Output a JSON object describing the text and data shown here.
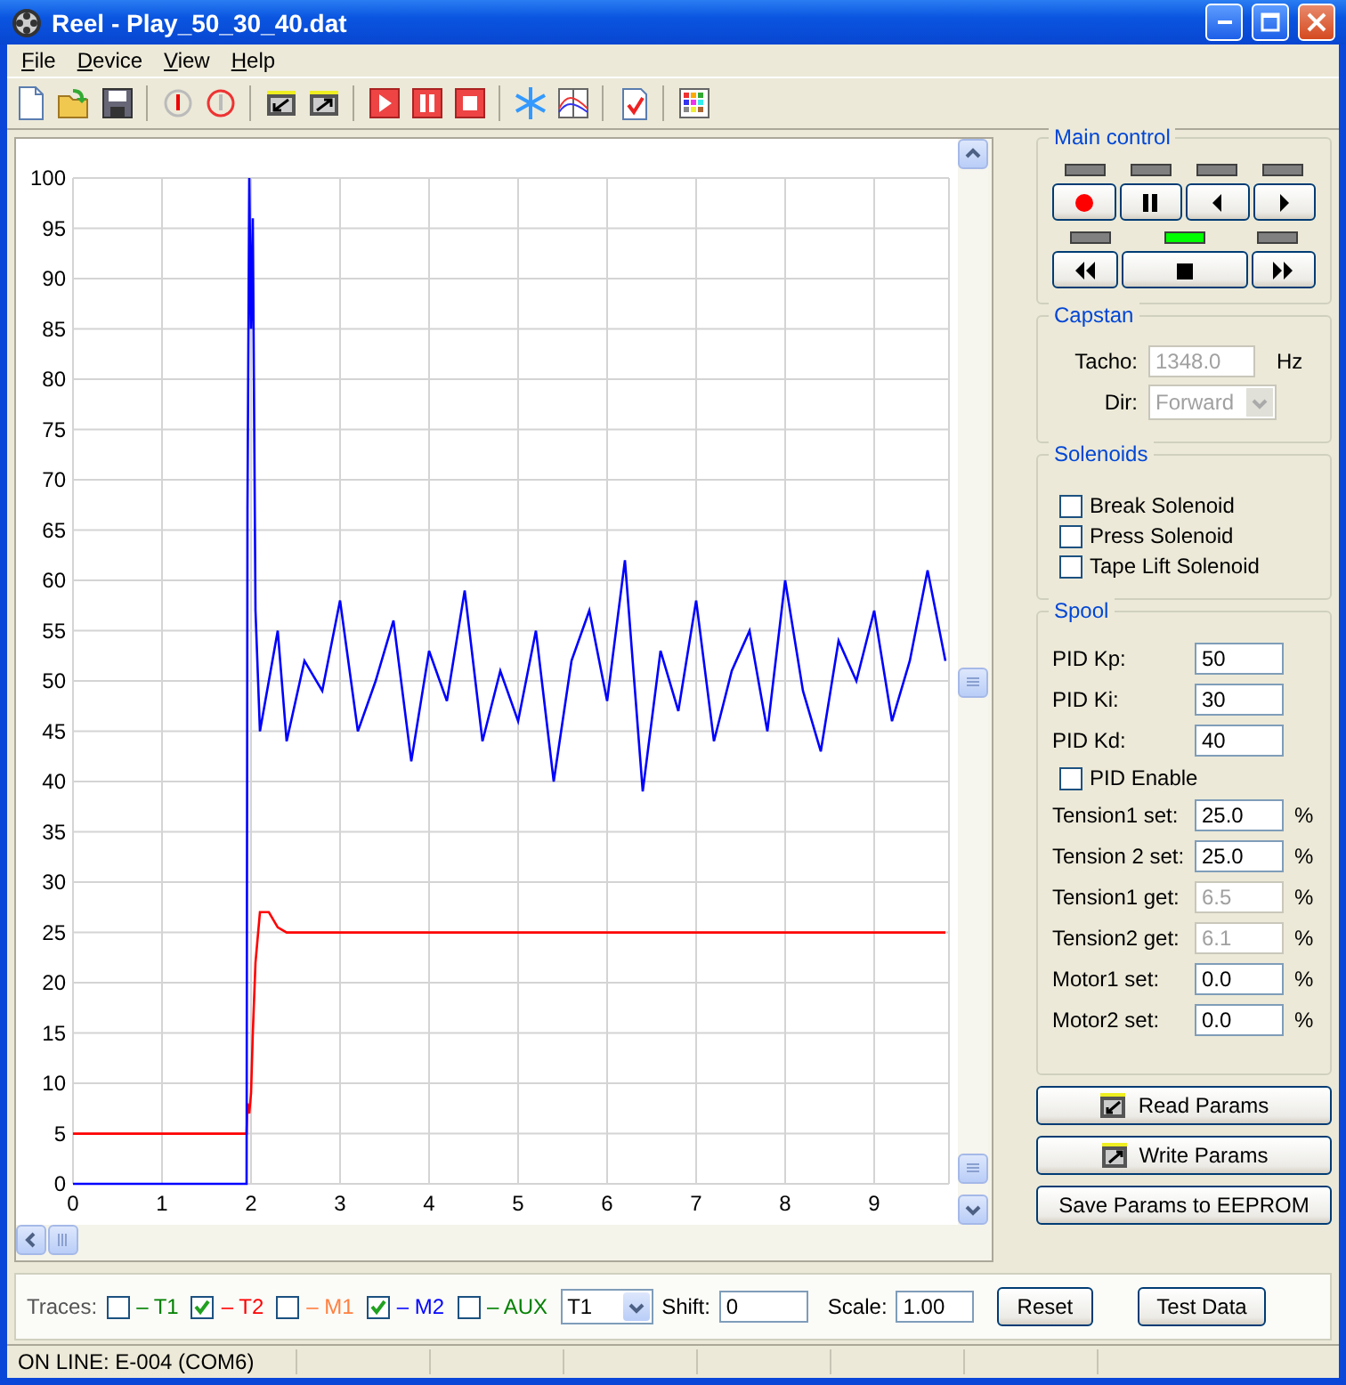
{
  "window": {
    "title": "Reel - Play_50_30_40.dat"
  },
  "menu": [
    "File",
    "Device",
    "View",
    "Help"
  ],
  "chart": {
    "chart_data": {
      "type": "line",
      "grid": true,
      "xlim": [
        0,
        9.84
      ],
      "ylim": [
        0,
        100
      ],
      "xticks": [
        0,
        1,
        2,
        3,
        4,
        5,
        6,
        7,
        8,
        9
      ],
      "yticks": [
        0,
        5,
        10,
        15,
        20,
        25,
        30,
        35,
        40,
        45,
        50,
        55,
        60,
        65,
        70,
        75,
        80,
        85,
        90,
        95,
        100
      ],
      "x": [
        0,
        1.95,
        1.96,
        1.98,
        2.0,
        2.02,
        2.05,
        2.1,
        2.2,
        2.3,
        2.4,
        2.6,
        2.8,
        3.0,
        3.2,
        3.4,
        3.6,
        3.8,
        4.0,
        4.2,
        4.4,
        4.6,
        4.8,
        5.0,
        5.2,
        5.4,
        5.6,
        5.8,
        6.0,
        6.2,
        6.4,
        6.6,
        6.8,
        7.0,
        7.2,
        7.4,
        7.6,
        7.8,
        8.0,
        8.2,
        8.4,
        8.6,
        8.8,
        9.0,
        9.2,
        9.4,
        9.6,
        9.8
      ],
      "series": [
        {
          "color": "#ff0000",
          "values": [
            5,
            5,
            8,
            7,
            9,
            15,
            22,
            27,
            27,
            25.5,
            25,
            25,
            25,
            25,
            25,
            25,
            25,
            25,
            25,
            25,
            25,
            25,
            25,
            25,
            25,
            25,
            25,
            25,
            25,
            25,
            25,
            25,
            25,
            25,
            25,
            25,
            25,
            25,
            25,
            25,
            25,
            25,
            25,
            25,
            25,
            25,
            25,
            25
          ]
        },
        {
          "color": "#0000ff",
          "values": [
            0,
            0,
            67,
            100,
            85,
            96,
            57,
            45,
            50,
            55,
            44,
            52,
            49,
            58,
            45,
            50,
            56,
            42,
            53,
            48,
            59,
            44,
            51,
            46,
            55,
            40,
            52,
            57,
            48,
            62,
            39,
            53,
            47,
            58,
            44,
            51,
            55,
            45,
            60,
            49,
            43,
            54,
            50,
            57,
            46,
            52,
            61,
            52
          ]
        }
      ]
    }
  },
  "main_control": {
    "title": "Main control",
    "leds_top": [
      {
        "on": false
      },
      {
        "on": false
      },
      {
        "on": false
      },
      {
        "on": false
      }
    ],
    "leds_bottom": [
      {
        "on": false
      },
      {
        "on": true
      },
      {
        "on": false
      }
    ]
  },
  "capstan": {
    "title": "Capstan",
    "tacho": {
      "label": "Tacho:",
      "value": "1348.0",
      "unit": "Hz",
      "disabled": true
    },
    "dir": {
      "label": "Dir:",
      "value": "Forward",
      "disabled": true
    }
  },
  "solenoids": {
    "title": "Solenoids",
    "items": [
      {
        "label": "Break Solenoid",
        "checked": false
      },
      {
        "label": "Press Solenoid",
        "checked": false
      },
      {
        "label": "Tape Lift Solenoid",
        "checked": false
      }
    ]
  },
  "spool": {
    "title": "Spool",
    "pid": [
      {
        "label": "PID Kp:",
        "value": "50"
      },
      {
        "label": "PID Ki:",
        "value": "30"
      },
      {
        "label": "PID Kd:",
        "value": "40"
      }
    ],
    "pid_enable": {
      "label": "PID Enable",
      "checked": false
    },
    "params": [
      {
        "label": "Tension1 set:",
        "value": "25.0",
        "unit": "%",
        "disabled": false
      },
      {
        "label": "Tension 2 set:",
        "value": "25.0",
        "unit": "%",
        "disabled": false
      },
      {
        "label": "Tension1 get:",
        "value": "6.5",
        "unit": "%",
        "disabled": true
      },
      {
        "label": "Tension2 get:",
        "value": "6.1",
        "unit": "%",
        "disabled": true
      },
      {
        "label": "Motor1 set:",
        "value": "0.0",
        "unit": "%",
        "disabled": false
      },
      {
        "label": "Motor2 set:",
        "value": "0.0",
        "unit": "%",
        "disabled": false
      }
    ]
  },
  "param_buttons": [
    {
      "label": "Read Params",
      "kind": "read"
    },
    {
      "label": "Write Params",
      "kind": "write"
    },
    {
      "label": "Save Params to EEPROM",
      "kind": "plain"
    }
  ],
  "traces": {
    "label": "Traces:",
    "items": [
      {
        "label": "– T1",
        "checked": false,
        "color": "#008000"
      },
      {
        "label": "– T2",
        "checked": true,
        "color": "#ff0000"
      },
      {
        "label": "– M1",
        "checked": false,
        "color": "#ff8040"
      },
      {
        "label": "– M2",
        "checked": true,
        "color": "#0000ff"
      },
      {
        "label": "– AUX",
        "checked": false,
        "color": "#008000"
      }
    ],
    "select": "T1",
    "shift": {
      "label": "Shift:",
      "value": "0"
    },
    "scale": {
      "label": "Scale:",
      "value": "1.00"
    },
    "buttons": [
      "Reset",
      "Test Data"
    ]
  },
  "status_bar": {
    "text": "ON LINE: E-004 (COM6)"
  }
}
